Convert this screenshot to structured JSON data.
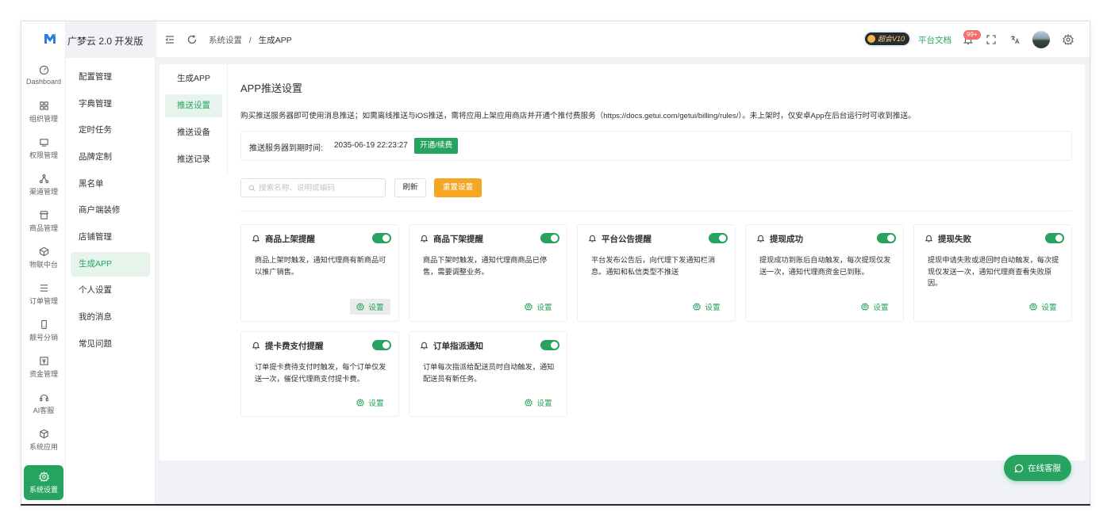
{
  "app": {
    "name": "广梦云 2.0 开发版"
  },
  "rail": {
    "items": [
      {
        "label": "Dashboard",
        "icon": "dashboard-icon"
      },
      {
        "label": "组织管理",
        "icon": "grid-icon"
      },
      {
        "label": "权限管理",
        "icon": "monitor-icon"
      },
      {
        "label": "渠道管理",
        "icon": "share-icon"
      },
      {
        "label": "商品管理",
        "icon": "store-icon"
      },
      {
        "label": "物联中台",
        "icon": "cube-icon"
      },
      {
        "label": "订单管理",
        "icon": "list-icon"
      },
      {
        "label": "靓号分销",
        "icon": "phone-icon"
      },
      {
        "label": "资金管理",
        "icon": "wallet-icon"
      },
      {
        "label": "AI客服",
        "icon": "headset-icon"
      },
      {
        "label": "系统应用",
        "icon": "box-icon"
      },
      {
        "label": "系统设置",
        "icon": "gear-icon"
      }
    ],
    "active": "系统设置"
  },
  "submenu": {
    "items": [
      "配置管理",
      "字典管理",
      "定时任务",
      "品牌定制",
      "黑名单",
      "商户端装修",
      "店铺管理",
      "生成APP",
      "个人设置",
      "我的消息",
      "常见问题"
    ],
    "active": "生成APP"
  },
  "header": {
    "breadcrumb": {
      "parent": "系统设置",
      "separator": "/",
      "current": "生成APP"
    },
    "vip_label": "超会V10",
    "docs_label": "平台文档",
    "notif_badge": "99+"
  },
  "tabs": {
    "items": [
      "生成APP",
      "推送设置",
      "推送设备",
      "推送记录"
    ],
    "active": "推送设置"
  },
  "page": {
    "title": "APP推送设置",
    "description": "购买推送服务器即可使用消息推送；如需离线推送与iOS推送，需将应用上架应用商店并开通个推付费服务（https://docs.getui.com/getui/billing/rules/）。未上架时，仅安卓App在后台运行时可收到推送。",
    "expire_label": "推送服务器到期时间:",
    "expire_time": "2035-06-19 22:23:27",
    "renew_button": "开通/续费"
  },
  "toolbar": {
    "search_placeholder": "搜索名称、说明或编码",
    "search_value": "",
    "refresh_label": "刷新",
    "reset_label": "重置设置"
  },
  "cards": [
    {
      "title": "商品上架提醒",
      "desc": "商品上架时触发，通知代理商有新商品可以推广销售。",
      "enabled": true,
      "setting_label": "设置"
    },
    {
      "title": "商品下架提醒",
      "desc": "商品下架时触发，通知代理商商品已停售，需要调整业务。",
      "enabled": true,
      "setting_label": "设置"
    },
    {
      "title": "平台公告提醒",
      "desc": "平台发布公告后，向代理下发通知栏消息。通知和私信类型不推送",
      "enabled": true,
      "setting_label": "设置"
    },
    {
      "title": "提现成功",
      "desc": "提现成功到账后自动触发，每次提现仅发送一次，通知代理商资金已到账。",
      "enabled": true,
      "setting_label": "设置"
    },
    {
      "title": "提现失败",
      "desc": "提现申请失败或退回时自动触发，每次提现仅发送一次，通知代理商查看失败原因。",
      "enabled": true,
      "setting_label": "设置"
    },
    {
      "title": "提卡费支付提醒",
      "desc": "订单提卡费待支付时触发，每个订单仅发送一次，催促代理商支付提卡费。",
      "enabled": true,
      "setting_label": "设置"
    },
    {
      "title": "订单指派通知",
      "desc": "订单每次指派给配送员时自动触发，通知配送员有新任务。",
      "enabled": true,
      "setting_label": "设置"
    }
  ],
  "chat": {
    "label": "在线客服"
  },
  "colors": {
    "accent": "#26a45f",
    "warning": "#f5a623",
    "danger": "#f56c6c"
  }
}
